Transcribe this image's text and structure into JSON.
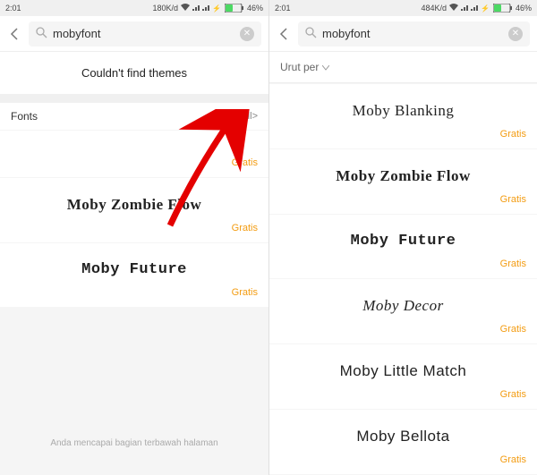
{
  "left": {
    "status": {
      "time": "2:01",
      "net": "180K/d",
      "battery": "46%"
    },
    "search": {
      "query": "mobyfont",
      "placeholder": ""
    },
    "not_found": "Couldn't find themes",
    "section_title": "Fonts",
    "view_all": "View all>",
    "fonts": [
      {
        "name": "",
        "price": "Gratis",
        "css": ""
      },
      {
        "name": "Moby Zombie Flow",
        "price": "Gratis",
        "css": "ff-zombie"
      },
      {
        "name": "Moby Future",
        "price": "Gratis",
        "css": "ff-future"
      }
    ],
    "footer": "Anda mencapai bagian terbawah halaman"
  },
  "right": {
    "status": {
      "time": "2:01",
      "net": "484K/d",
      "battery": "46%"
    },
    "search": {
      "query": "mobyfont",
      "placeholder": ""
    },
    "sort_label": "Urut per",
    "fonts": [
      {
        "name": "Moby Blanking",
        "price": "Gratis",
        "css": "ff-blanking"
      },
      {
        "name": "Moby Zombie Flow",
        "price": "Gratis",
        "css": "ff-zombie"
      },
      {
        "name": "Moby Future",
        "price": "Gratis",
        "css": "ff-future"
      },
      {
        "name": "Moby Decor",
        "price": "Gratis",
        "css": "ff-decor"
      },
      {
        "name": "Moby Little Match",
        "price": "Gratis",
        "css": "ff-little"
      },
      {
        "name": "Moby Bellota",
        "price": "Gratis",
        "css": "ff-bellota"
      }
    ]
  },
  "icons": {
    "wifi": "wifi-icon",
    "signal": "signal-icon",
    "charge": "lightning-icon"
  }
}
